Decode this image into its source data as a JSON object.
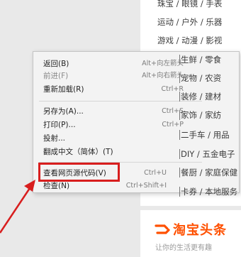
{
  "background": {
    "top_categories": [
      "珠宝 / 眼镜 / 手表",
      "运动 / 户外 / 乐器",
      "游戏 / 动漫 / 影视"
    ],
    "side_categories": [
      "生鲜 / 零食",
      "宠物 / 农资",
      "装修 / 建材",
      "家饰 / 家纺",
      "二手车 / 用品",
      "DIY / 五金电子",
      "餐厨 / 家庭保健",
      "卡券 / 本地服务"
    ],
    "banner": {
      "title": "淘宝头条",
      "subtitle": "让你的生活更有趣"
    }
  },
  "menu": {
    "groups": [
      [
        {
          "label": "返回(B)",
          "shortcut": "Alt+向左箭头",
          "enabled": true
        },
        {
          "label": "前进(F)",
          "shortcut": "Alt+向右箭头",
          "enabled": false
        },
        {
          "label": "重新加载(R)",
          "shortcut": "Ctrl+R",
          "enabled": true
        }
      ],
      [
        {
          "label": "另存为(A)...",
          "shortcut": "Ctrl+S",
          "enabled": true
        },
        {
          "label": "打印(P)...",
          "shortcut": "Ctrl+P",
          "enabled": true
        },
        {
          "label": "投射...",
          "shortcut": "",
          "enabled": true
        },
        {
          "label": "翻成中文（简体）(T)",
          "shortcut": "",
          "enabled": true
        }
      ],
      [
        {
          "label": "查看网页源代码(V)",
          "shortcut": "Ctrl+U",
          "enabled": true,
          "highlighted": true
        },
        {
          "label": "检查(N)",
          "shortcut": "Ctrl+Shift+I",
          "enabled": true
        }
      ]
    ]
  },
  "colors": {
    "highlight": "#d81e1e",
    "brand": "#ff5000"
  }
}
